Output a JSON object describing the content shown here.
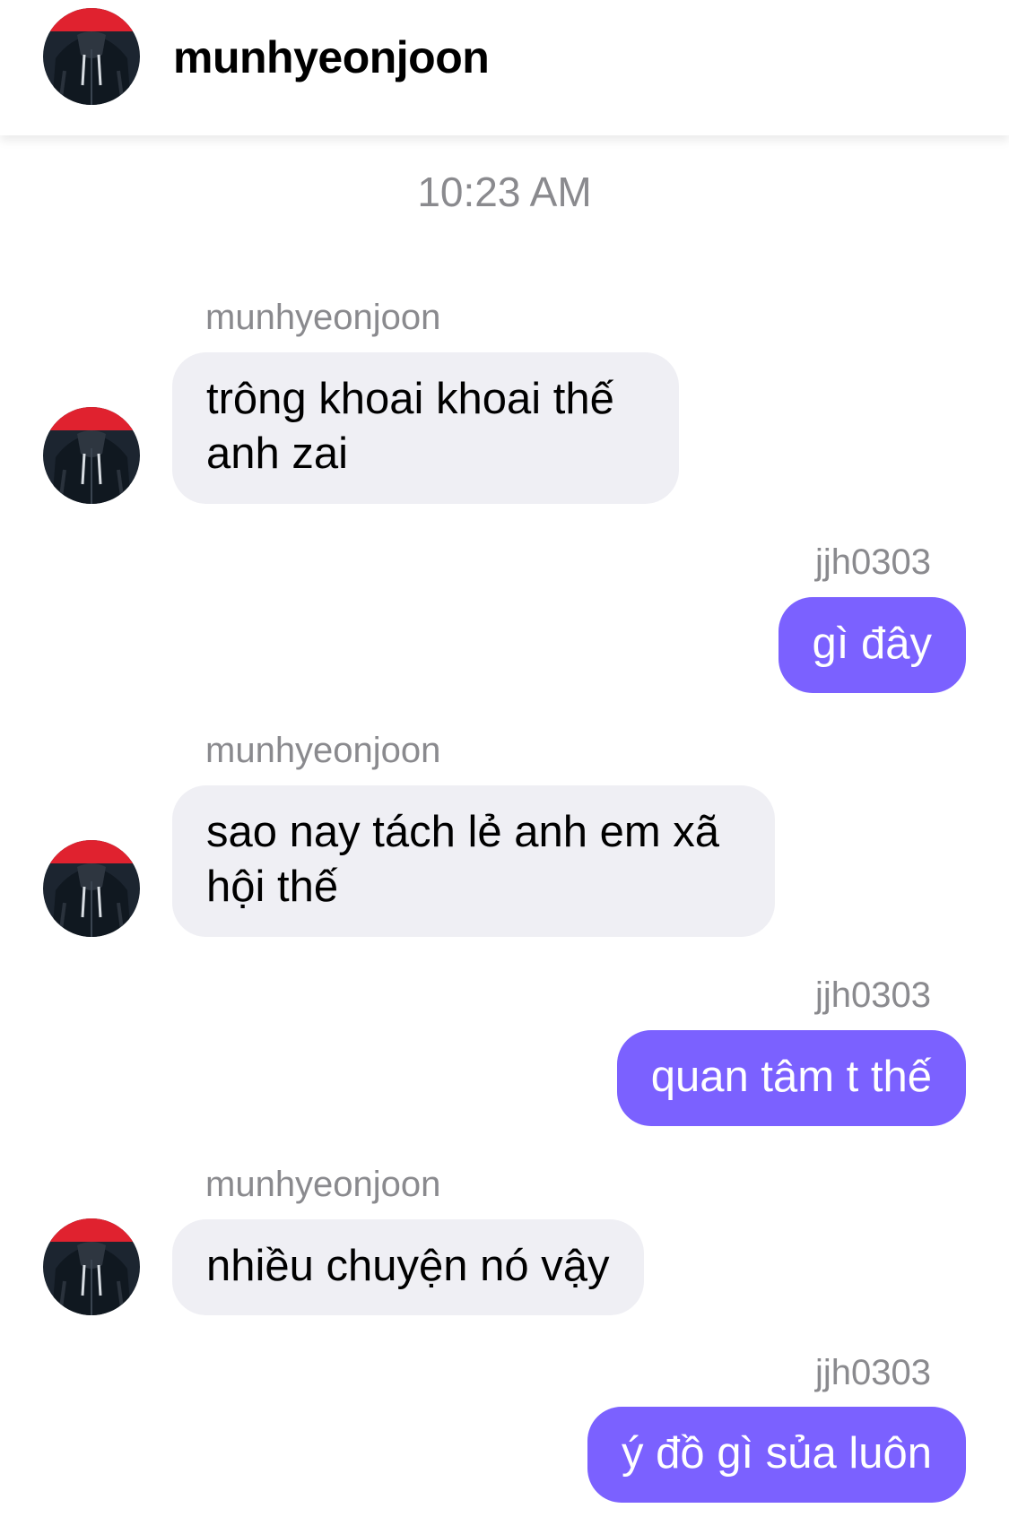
{
  "header": {
    "contact_name": "munhyeonjoon",
    "avatar_icon": "user-avatar-icon"
  },
  "conversation": {
    "timestamp": "10:23 AM",
    "messages": [
      {
        "sender": "munhyeonjoon",
        "direction": "incoming",
        "text": "trông khoai khoai thế anh zai"
      },
      {
        "sender": "jjh0303",
        "direction": "outgoing",
        "text": "gì đây"
      },
      {
        "sender": "munhyeonjoon",
        "direction": "incoming",
        "text": "sao nay tách lẻ anh em xã hội thế"
      },
      {
        "sender": "jjh0303",
        "direction": "outgoing",
        "text": "quan tâm t thế"
      },
      {
        "sender": "munhyeonjoon",
        "direction": "incoming",
        "text": "nhiều chuyện nó vậy"
      },
      {
        "sender": "jjh0303",
        "direction": "outgoing",
        "text": "ý đồ gì sủa luôn"
      }
    ]
  },
  "colors": {
    "outgoing_bubble": "#7b61ff",
    "incoming_bubble": "#efeff4",
    "secondary_text": "#8a8a8e",
    "avatar_accent": "#e0222f"
  }
}
